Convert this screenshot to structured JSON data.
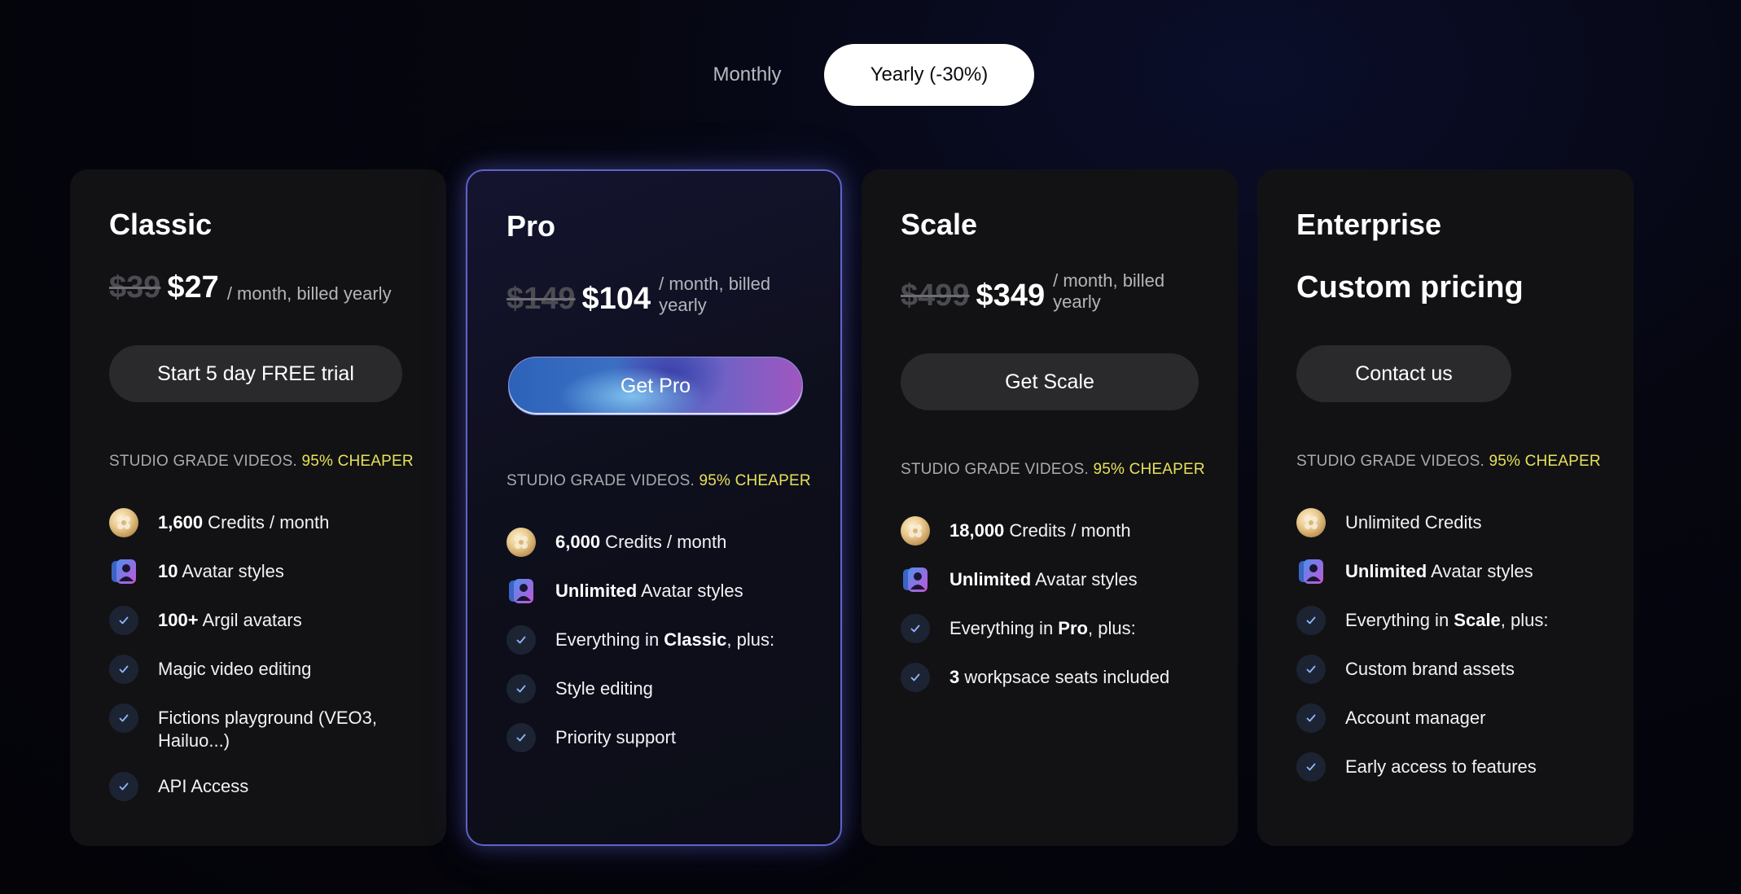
{
  "billing_toggle": {
    "monthly": "Monthly",
    "yearly": "Yearly (-30%)",
    "selected": "yearly"
  },
  "colors": {
    "highlight": "#e6e15a",
    "pro_border": "#5f63c9",
    "background": "#05060f",
    "card": "#121214"
  },
  "plans": [
    {
      "name": "Classic",
      "old_price": "$39",
      "price": "$27",
      "billing": "/ month, billed yearly",
      "cta": "Start 5 day FREE trial",
      "studio": "STUDIO GRADE VIDEOS.",
      "studio_highlight": "95% CHEAPER",
      "features": [
        {
          "icon": "coin-icon",
          "bold": "1,600",
          "text": " Credits / month"
        },
        {
          "icon": "avatar-styles-icon",
          "bold": "10",
          "text": " Avatar styles"
        },
        {
          "icon": "check-icon",
          "bold": "100+",
          "text": " Argil avatars"
        },
        {
          "icon": "check-icon",
          "text": "Magic video editing"
        },
        {
          "icon": "check-icon",
          "text": "Fictions playground (VEO3, Hailuo...)"
        },
        {
          "icon": "check-icon",
          "text": "API Access"
        }
      ]
    },
    {
      "name": "Pro",
      "old_price": "$149",
      "price": "$104",
      "billing": "/ month, billed yearly",
      "cta": "Get Pro",
      "studio": "STUDIO GRADE VIDEOS.",
      "studio_highlight": "95% CHEAPER",
      "features": [
        {
          "icon": "coin-icon",
          "bold": "6,000",
          "text": " Credits / month"
        },
        {
          "icon": "avatar-styles-icon",
          "bold": "Unlimited",
          "text": " Avatar styles"
        },
        {
          "icon": "check-icon",
          "pre": "Everything in ",
          "bold": "Classic",
          "text": ", plus:"
        },
        {
          "icon": "check-icon",
          "text": "Style editing"
        },
        {
          "icon": "check-icon",
          "text": "Priority support"
        }
      ]
    },
    {
      "name": "Scale",
      "old_price": "$499",
      "price": "$349",
      "billing": "/ month, billed yearly",
      "cta": "Get Scale",
      "studio": "STUDIO GRADE VIDEOS.",
      "studio_highlight": "95% CHEAPER",
      "features": [
        {
          "icon": "coin-icon",
          "bold": "18,000",
          "text": " Credits / month"
        },
        {
          "icon": "avatar-styles-icon",
          "bold": "Unlimited",
          "text": " Avatar styles"
        },
        {
          "icon": "check-icon",
          "pre": "Everything in ",
          "bold": "Pro",
          "text": ", plus:"
        },
        {
          "icon": "check-icon",
          "bold": "3",
          "text": " workpsace seats included"
        }
      ]
    },
    {
      "name": "Enterprise",
      "custom_price": "Custom pricing",
      "cta": "Contact us",
      "studio": "STUDIO GRADE VIDEOS.",
      "studio_highlight": "95% CHEAPER",
      "features": [
        {
          "icon": "coin-icon",
          "text": "Unlimited Credits"
        },
        {
          "icon": "avatar-styles-icon",
          "bold": "Unlimited",
          "text": " Avatar styles"
        },
        {
          "icon": "check-icon",
          "pre": "Everything in ",
          "bold": "Scale",
          "text": ", plus:"
        },
        {
          "icon": "check-icon",
          "text": "Custom brand assets"
        },
        {
          "icon": "check-icon",
          "text": "Account manager"
        },
        {
          "icon": "check-icon",
          "text": "Early access to features"
        }
      ]
    }
  ]
}
